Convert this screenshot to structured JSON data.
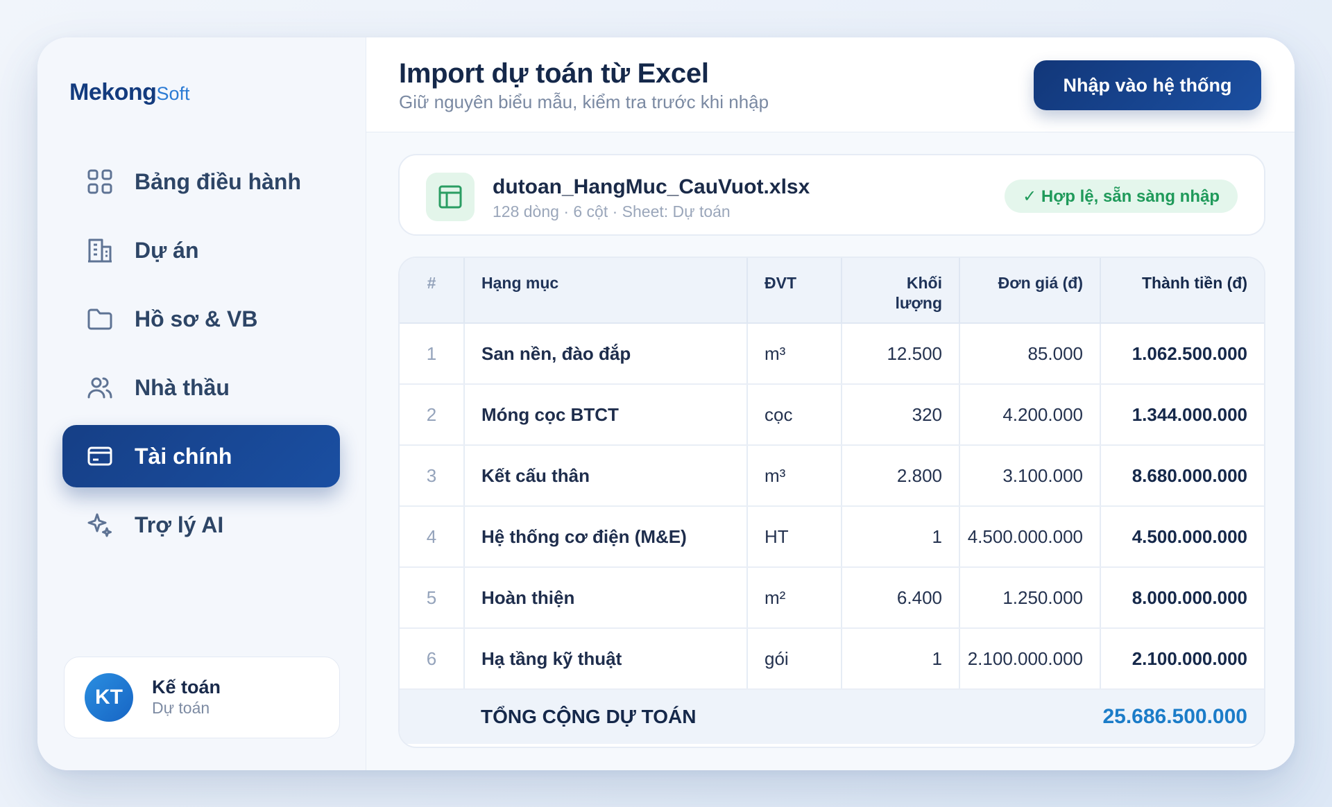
{
  "brand": {
    "main": "Mekong",
    "suffix": "Soft"
  },
  "sidebar": {
    "items": [
      {
        "label": "Bảng điều hành",
        "icon": "grid-icon",
        "active": false
      },
      {
        "label": "Dự án",
        "icon": "building-icon",
        "active": false
      },
      {
        "label": "Hồ sơ & VB",
        "icon": "folder-icon",
        "active": false
      },
      {
        "label": "Nhà thầu",
        "icon": "users-icon",
        "active": false
      },
      {
        "label": "Tài chính",
        "icon": "card-icon",
        "active": true
      },
      {
        "label": "Trợ lý AI",
        "icon": "sparkle-icon",
        "active": false
      }
    ]
  },
  "user": {
    "initials": "KT",
    "name": "Kế toán",
    "role": "Dự toán"
  },
  "header": {
    "title": "Import dự toán từ Excel",
    "subtitle": "Giữ nguyên biểu mẫu, kiểm tra trước khi nhập",
    "import_button": "Nhập vào hệ thống"
  },
  "file": {
    "name": "dutoan_HangMuc_CauVuot.xlsx",
    "meta": "128 dòng · 6 cột · Sheet: Dự toán",
    "status": "✓ Hợp lệ, sẵn sàng nhập",
    "status_color": "#1f9a5a"
  },
  "table": {
    "headers": {
      "idx": "#",
      "name": "Hạng mục",
      "unit": "ĐVT",
      "qty_line1": "Khối",
      "qty_line2": "lượng",
      "price": "Đơn giá (đ)",
      "total": "Thành tiền (đ)"
    },
    "rows": [
      {
        "idx": "1",
        "name": "San nền, đào đắp",
        "unit": "m³",
        "qty": "12.500",
        "price": "85.000",
        "total": "1.062.500.000"
      },
      {
        "idx": "2",
        "name": "Móng cọc BTCT",
        "unit": "cọc",
        "qty": "320",
        "price": "4.200.000",
        "total": "1.344.000.000"
      },
      {
        "idx": "3",
        "name": "Kết cấu thân",
        "unit": "m³",
        "qty": "2.800",
        "price": "3.100.000",
        "total": "8.680.000.000"
      },
      {
        "idx": "4",
        "name": "Hệ thống cơ điện (M&E)",
        "unit": "HT",
        "qty": "1",
        "price": "4.500.000.000",
        "total": "4.500.000.000"
      },
      {
        "idx": "5",
        "name": "Hoàn thiện",
        "unit": "m²",
        "qty": "6.400",
        "price": "1.250.000",
        "total": "8.000.000.000"
      },
      {
        "idx": "6",
        "name": "Hạ tầng kỹ thuật",
        "unit": "gói",
        "qty": "1",
        "price": "2.100.000.000",
        "total": "2.100.000.000"
      }
    ],
    "footer": {
      "label": "TỔNG CỘNG DỰ TOÁN",
      "value": "25.686.500.000",
      "value_color": "#1b7cc8"
    }
  },
  "colors": {
    "primary": "#163f86",
    "accent": "#2b7bd4",
    "success": "#1f9a5a"
  }
}
